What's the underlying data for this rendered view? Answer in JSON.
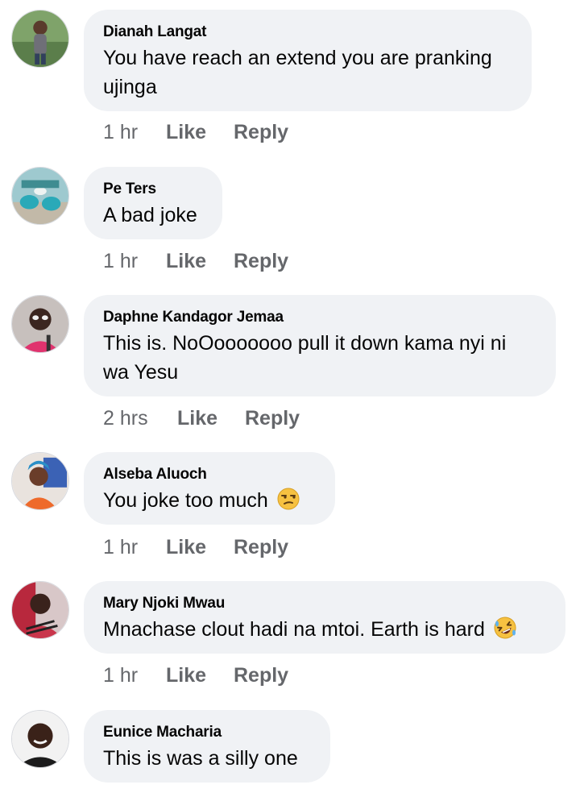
{
  "comments": [
    {
      "author": "Dianah Langat",
      "text": "You have reach an extend you are pranking ujinga",
      "time": "1 hr",
      "like": "Like",
      "reply": "Reply"
    },
    {
      "author": "Pe Ters",
      "text": "A bad joke",
      "time": "1 hr",
      "like": "Like",
      "reply": "Reply"
    },
    {
      "author": "Daphne Kandagor Jemaa",
      "text": "This is. NoOooooooo pull it down kama nyi ni wa Yesu",
      "time": "2 hrs",
      "like": "Like",
      "reply": "Reply"
    },
    {
      "author": "Alseba Aluoch",
      "text": "You joke too much",
      "emoji": "unamused-face-icon",
      "time": "1 hr",
      "like": "Like",
      "reply": "Reply"
    },
    {
      "author": "Mary Njoki Mwau",
      "text": "Mnachase clout hadi na mtoi. Earth is hard",
      "emoji": "rolling-laughing-face-icon",
      "time": "1 hr",
      "like": "Like",
      "reply": "Reply"
    },
    {
      "author": "Eunice Macharia",
      "text": "This is was a silly one"
    }
  ],
  "colors": {
    "bubble": "#f0f2f5",
    "meta_text": "#65676b",
    "text": "#050505"
  }
}
